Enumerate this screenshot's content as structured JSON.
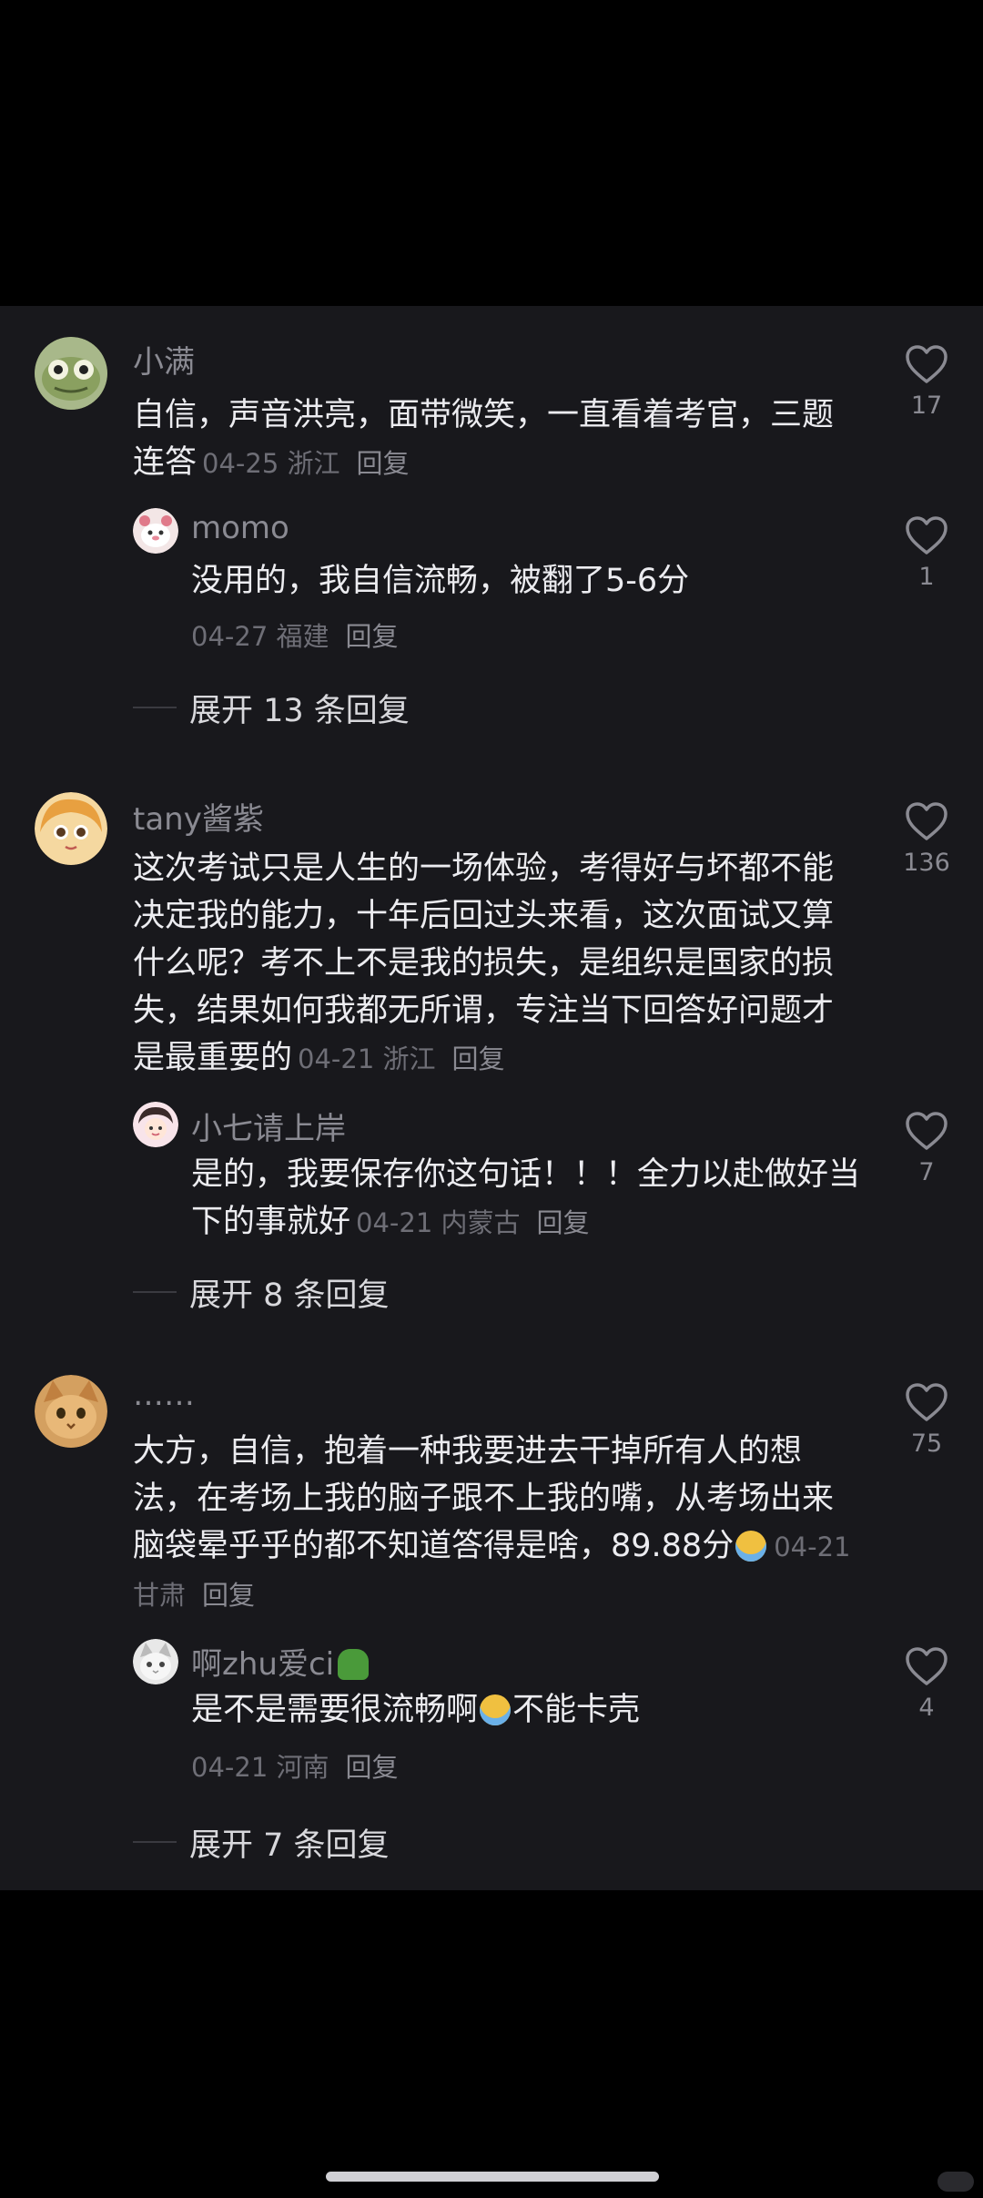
{
  "comments": [
    {
      "name": "小满",
      "text": "自信，声音洪亮，面带微笑，一直看着考官，三题连答",
      "date": "04-25",
      "location": "浙江",
      "reply_label": "回复",
      "likes": "17",
      "sub": {
        "name": "momo",
        "text": "没用的，我自信流畅，被翻了5-6分",
        "date": "04-27",
        "location": "福建",
        "reply_label": "回复",
        "likes": "1"
      },
      "expand_label": "展开 13 条回复"
    },
    {
      "name": "tany酱紫",
      "text": "这次考试只是人生的一场体验，考得好与坏都不能决定我的能力，十年后回过头来看，这次面试又算什么呢？考不上不是我的损失，是组织是国家的损失，结果如何我都无所谓，专注当下回答好问题才是最重要的",
      "date": "04-21",
      "location": "浙江",
      "reply_label": "回复",
      "likes": "136",
      "sub": {
        "name": "小七请上岸",
        "text": "是的，我要保存你这句话！！！全力以赴做好当下的事就好",
        "date": "04-21",
        "location": "内蒙古",
        "reply_label": "回复",
        "likes": "7"
      },
      "expand_label": "展开 8 条回复"
    },
    {
      "name": "……",
      "text": "大方，自信，抱着一种我要进去干掉所有人的想法，在考场上我的脑子跟不上我的嘴，从考场出来脑袋晕乎乎的都不知道答得是啥，89.88分",
      "date": "04-21",
      "location": "甘肃",
      "reply_label": "回复",
      "likes": "75",
      "sub": {
        "name": "啊zhu爱ci",
        "text_a": "是不是需要很流畅啊",
        "text_b": "不能卡壳",
        "date": "04-21",
        "location": "河南",
        "reply_label": "回复",
        "likes": "4"
      },
      "expand_label": "展开 7 条回复"
    }
  ],
  "icons": {
    "like": "heart-outline-icon",
    "emoji_crying": "crying-face-emoji",
    "emoji_broccoli": "broccoli-emoji"
  },
  "colors": {
    "background": "#000000",
    "panel": "#18181c",
    "text_primary": "#ececf0",
    "text_secondary": "#8a8a92",
    "text_meta": "#6e6e76"
  }
}
